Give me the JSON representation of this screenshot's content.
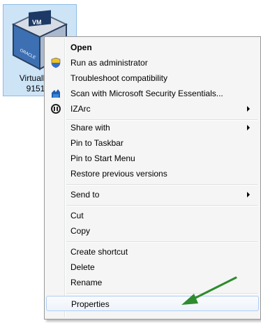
{
  "desktop_icon": {
    "caption_line1": "VirtualBox-",
    "caption_line2": "9151-V",
    "logo_text": "ORACLE",
    "icon": "virtualbox-cube-icon"
  },
  "context_menu": {
    "items": [
      {
        "label": "Open",
        "icon": ""
      },
      {
        "label": "Run as administrator",
        "icon": "uac-shield-icon"
      },
      {
        "label": "Troubleshoot compatibility",
        "icon": ""
      },
      {
        "label": "Scan with Microsoft Security Essentials...",
        "icon": "security-essentials-icon"
      },
      {
        "label": "IZArc",
        "icon": "izarc-icon"
      },
      {
        "label": "Share with",
        "icon": ""
      },
      {
        "label": "Pin to Taskbar",
        "icon": ""
      },
      {
        "label": "Pin to Start Menu",
        "icon": ""
      },
      {
        "label": "Restore previous versions",
        "icon": ""
      },
      {
        "label": "Send to",
        "icon": ""
      },
      {
        "label": "Cut",
        "icon": ""
      },
      {
        "label": "Copy",
        "icon": ""
      },
      {
        "label": "Create shortcut",
        "icon": ""
      },
      {
        "label": "Delete",
        "icon": ""
      },
      {
        "label": "Rename",
        "icon": ""
      },
      {
        "label": "Properties",
        "icon": ""
      }
    ]
  },
  "annotation": {
    "icon": "green-pointer-arrow-icon",
    "color": "#2e8b2e"
  },
  "colors": {
    "highlight_border": "#aecff7",
    "menu_bg": "#f5f5f5",
    "icon_selection": "#cde4f7"
  }
}
